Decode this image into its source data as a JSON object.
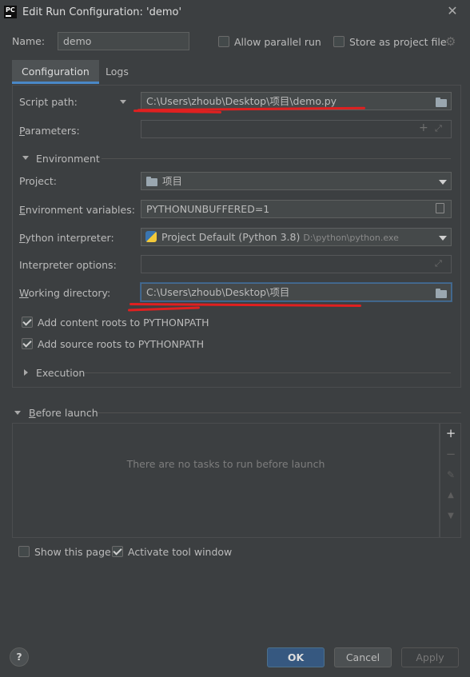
{
  "window": {
    "title": "Edit Run Configuration: 'demo'",
    "app_icon_text": "PC"
  },
  "header": {
    "name_label": "Name:",
    "name_value": "demo",
    "allow_parallel_label": "Allow parallel run",
    "allow_parallel_checked": false,
    "store_project_label": "Store as project file",
    "store_project_checked": false
  },
  "tabs": [
    {
      "label": "Configuration",
      "active": true
    },
    {
      "label": "Logs",
      "active": false
    }
  ],
  "config": {
    "script_path_label": "Script path:",
    "script_path_value": "C:\\Users\\zhoub\\Desktop\\项目\\demo.py",
    "parameters_label": "Parameters:",
    "parameters_value": "",
    "environment_label": "Environment",
    "project_label": "Project:",
    "project_value": "项目",
    "env_vars_label": "Environment variables:",
    "env_vars_value": "PYTHONUNBUFFERED=1",
    "interpreter_label": "Python interpreter:",
    "interpreter_value": "Project Default (Python 3.8)",
    "interpreter_path": "D:\\python\\python.exe",
    "interpreter_options_label": "Interpreter options:",
    "interpreter_options_value": "",
    "working_dir_label": "Working directory:",
    "working_dir_value": "C:\\Users\\zhoub\\Desktop\\项目",
    "add_content_roots_label": "Add content roots to PYTHONPATH",
    "add_content_roots_checked": true,
    "add_source_roots_label": "Add source roots to PYTHONPATH",
    "add_source_roots_checked": true,
    "execution_label": "Execution"
  },
  "before_launch": {
    "label": "Before launch",
    "empty_text": "There are no tasks to run before launch"
  },
  "footer": {
    "show_page_label": "Show this page",
    "show_page_checked": false,
    "activate_tool_label": "Activate tool window",
    "activate_tool_checked": true,
    "help_label": "?",
    "ok_label": "OK",
    "cancel_label": "Cancel",
    "apply_label": "Apply"
  },
  "colors": {
    "background": "#3c3f41",
    "accent": "#4a88c7",
    "primary_button": "#365880",
    "annotation": "#e02020"
  }
}
